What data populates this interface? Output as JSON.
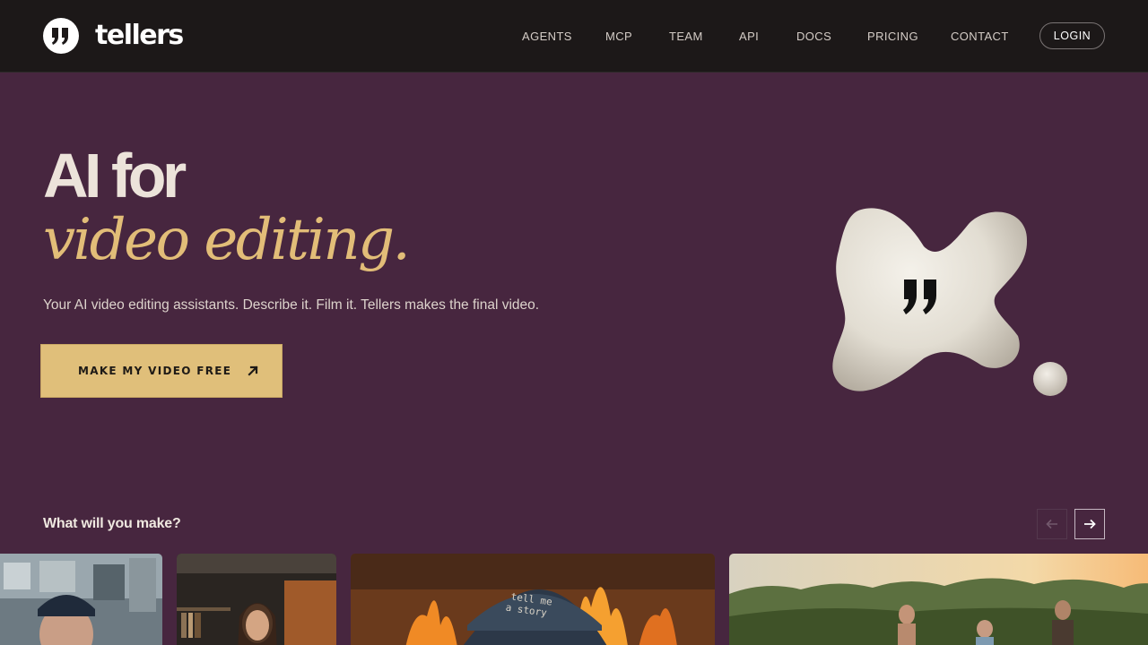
{
  "brand": {
    "name": "tellers"
  },
  "nav": {
    "items": [
      "AGENTS",
      "MCP",
      "TEAM",
      "API",
      "DOCS",
      "PRICING",
      "CONTACT"
    ],
    "login_label": "LOGIN"
  },
  "hero": {
    "title_line1": "AI for",
    "title_line2": "video editing.",
    "subtitle": "Your AI video editing assistants. Describe it. Film it. Tellers makes the final video.",
    "cta_label": "MAKE MY VIDEO FREE"
  },
  "gallery": {
    "title": "What will you make?",
    "prev_icon": "arrow-left-icon",
    "next_icon": "arrow-right-icon",
    "cards": [
      {
        "name": "video-card-office-man"
      },
      {
        "name": "video-card-woman-room"
      },
      {
        "name": "video-card-cap-fire",
        "cap_text": "tell me a story"
      },
      {
        "name": "video-card-outdoor-running"
      }
    ]
  },
  "colors": {
    "background": "#47263f",
    "nav_background": "#1c1818",
    "accent_gold": "#e2bd78",
    "cta_background": "#e0bf7a",
    "text_light": "#ece3da"
  }
}
